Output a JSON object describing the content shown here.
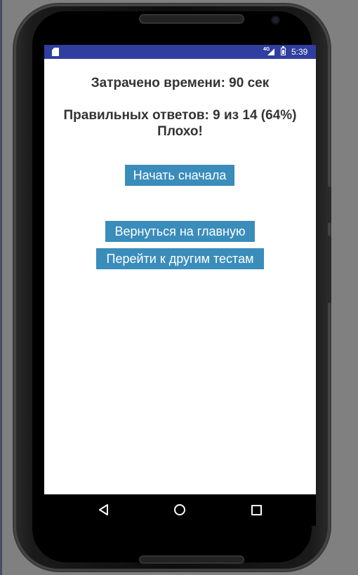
{
  "status_bar": {
    "network": "4G",
    "time": "5:39",
    "bar_color": "#303f9f"
  },
  "results": {
    "time_spent": "Затрачено времени: 90 сек",
    "correct_answers": "Правильных ответов: 9 из 14 (64%)",
    "verdict": "Плохо!"
  },
  "buttons": {
    "restart": "Начать сначала",
    "go_home": "Вернуться на главную",
    "other_tests": "Перейти к другим тестам",
    "color": "#3a8dbb"
  },
  "nav_bar": {
    "icons": [
      "back-icon",
      "home-icon",
      "recent-apps-icon"
    ]
  }
}
